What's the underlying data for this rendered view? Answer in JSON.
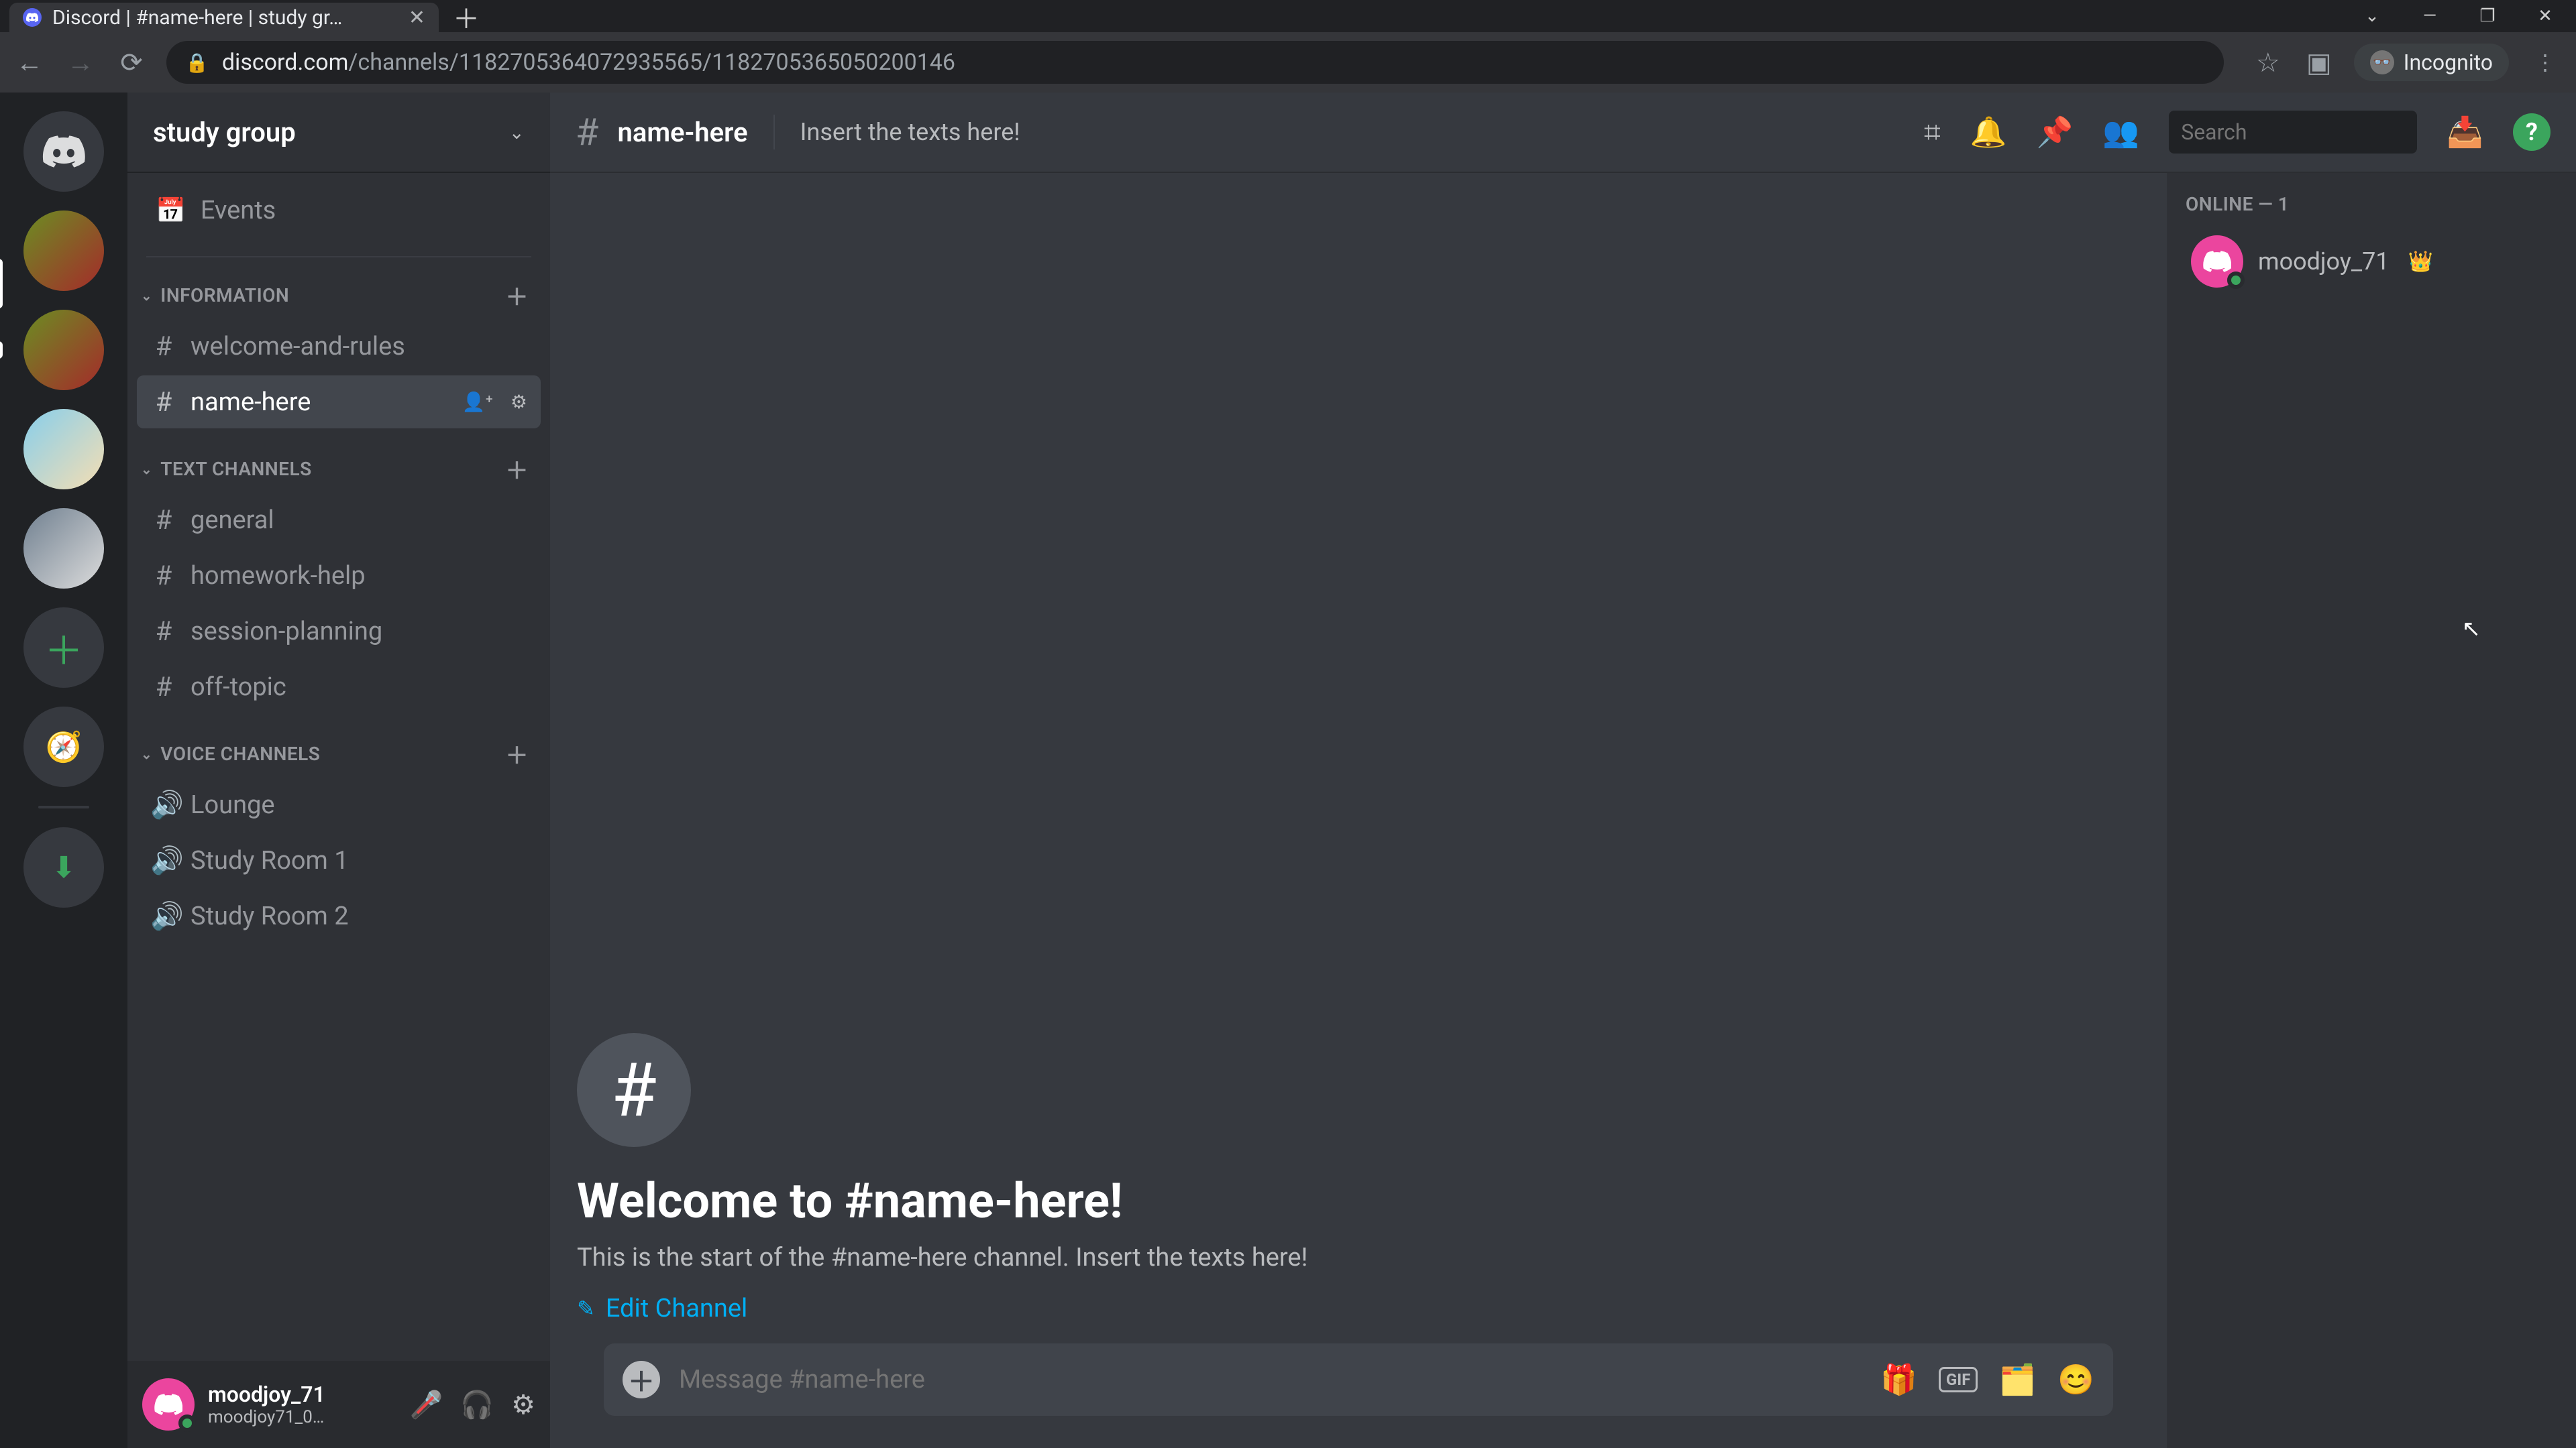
{
  "browser": {
    "tab_title": "Discord | #name-here | study gr…",
    "url_scheme": "discord.com",
    "url_path": "/channels/1182705364072935565/1182705365050200146",
    "incognito_label": "Incognito"
  },
  "server_rail": {
    "home_label": "Home"
  },
  "sidebar": {
    "server_name": "study group",
    "events_label": "Events",
    "categories": [
      {
        "name": "INFORMATION",
        "type": "text"
      },
      {
        "name": "TEXT CHANNELS",
        "type": "text"
      },
      {
        "name": "VOICE CHANNELS",
        "type": "voice"
      }
    ],
    "info_channels": [
      {
        "name": "welcome-and-rules"
      },
      {
        "name": "name-here",
        "active": true
      }
    ],
    "text_channels": [
      {
        "name": "general"
      },
      {
        "name": "homework-help"
      },
      {
        "name": "session-planning"
      },
      {
        "name": "off-topic"
      }
    ],
    "voice_channels": [
      {
        "name": "Lounge"
      },
      {
        "name": "Study Room 1"
      },
      {
        "name": "Study Room 2"
      }
    ]
  },
  "user_panel": {
    "username": "moodjoy_71",
    "subtext": "moodjoy71_0…"
  },
  "channel_header": {
    "name": "name-here",
    "topic": "Insert the texts here!",
    "search_placeholder": "Search"
  },
  "welcome": {
    "heading": "Welcome to #name-here!",
    "subtext": "This is the start of the #name-here channel. Insert the texts here!",
    "edit_label": "Edit Channel"
  },
  "composer": {
    "placeholder": "Message #name-here"
  },
  "members": {
    "online_heading": "ONLINE — 1",
    "list": [
      {
        "name": "moodjoy_71",
        "owner": true
      }
    ]
  }
}
